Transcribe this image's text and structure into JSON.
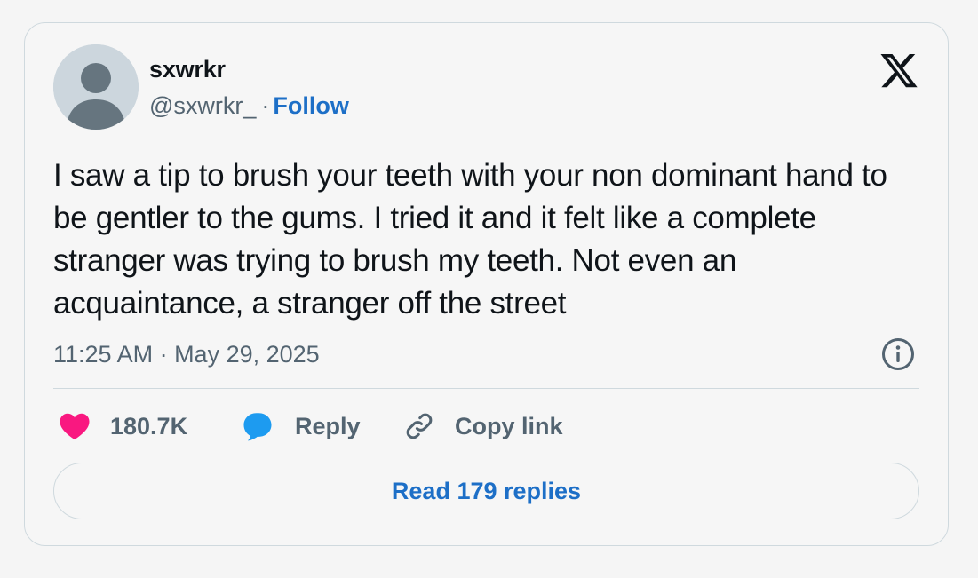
{
  "author": {
    "display_name": "sxwrkr",
    "handle": "@sxwrkr_",
    "separator": "·",
    "follow_label": "Follow"
  },
  "logo": {
    "icon": "x-logo-icon"
  },
  "tweet": {
    "text": "I saw a tip to brush your teeth with your non dominant hand to be gentler to the gums. I tried it and it felt like a complete stranger was trying to brush my teeth. Not even an acquaintance, a stranger off the street",
    "timestamp": "11:25 AM · May 29, 2025"
  },
  "actions": {
    "likes": "180.7K",
    "reply_label": "Reply",
    "copy_link_label": "Copy link"
  },
  "read_replies_label": "Read 179 replies",
  "colors": {
    "like": "#f91880",
    "reply": "#1d9bf0",
    "link": "#1d6fc7",
    "muted": "#536471",
    "text": "#0f1419",
    "border": "#cfd9de"
  }
}
